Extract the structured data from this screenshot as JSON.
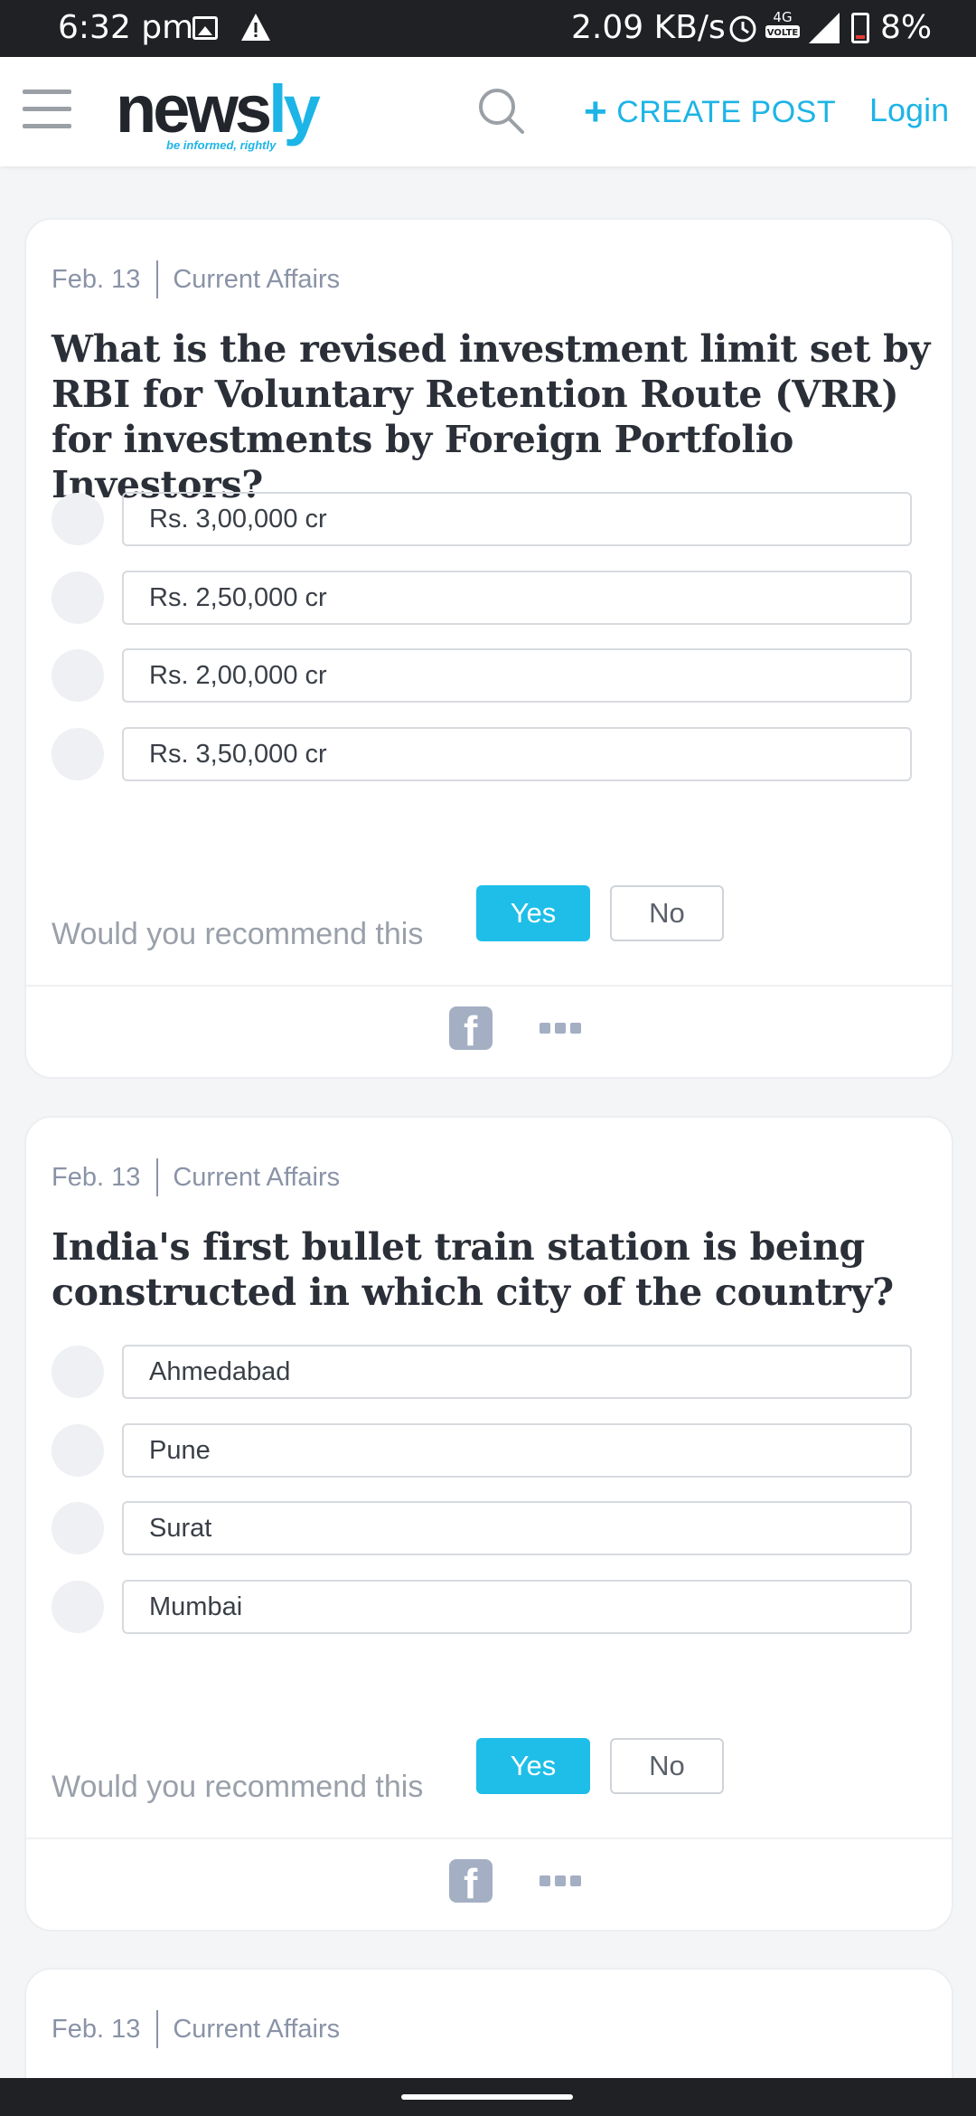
{
  "status_bar": {
    "time": "6:32 pm",
    "network_speed": "2.09 KB/s",
    "network_type": "4G",
    "volte_label": "VOLTE",
    "battery": "8%"
  },
  "header": {
    "logo_main": "news",
    "logo_accent": "ly",
    "tagline": "be informed, rightly",
    "create_post_label": "CREATE POST",
    "login_label": "Login",
    "accent_color": "#1db4e6"
  },
  "cards": [
    {
      "date": "Feb. 13",
      "category": "Current Affairs",
      "question": "What is the revised investment limit set by RBI for Voluntary Retention Route (VRR) for investments by Foreign Portfolio Investors?",
      "options": [
        "Rs. 3,00,000 cr",
        "Rs. 2,50,000 cr",
        "Rs. 2,00,000 cr",
        "Rs. 3,50,000 cr"
      ],
      "recommend_label": "Would you recommend this",
      "yes_label": "Yes",
      "no_label": "No"
    },
    {
      "date": "Feb. 13",
      "category": "Current Affairs",
      "question": "India's first bullet train station is being constructed in which city of the country?",
      "options": [
        "Ahmedabad",
        "Pune",
        "Surat",
        "Mumbai"
      ],
      "recommend_label": "Would you recommend this",
      "yes_label": "Yes",
      "no_label": "No"
    },
    {
      "date": "Feb. 13",
      "category": "Current Affairs"
    }
  ]
}
